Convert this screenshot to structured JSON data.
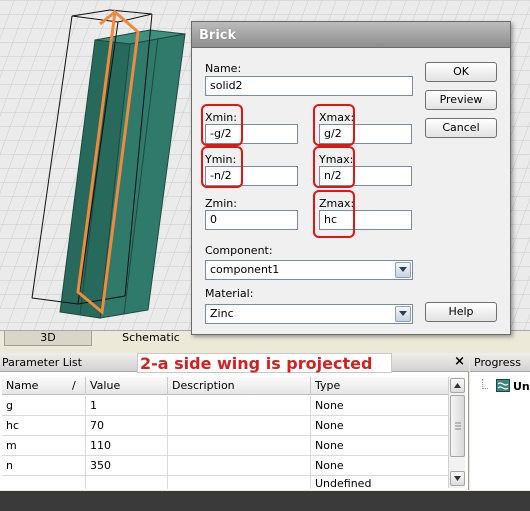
{
  "viewport": {
    "tabs": [
      "3D",
      "Schematic"
    ]
  },
  "dialog": {
    "title": "Brick",
    "name_label": "Name:",
    "name_value": "solid2",
    "xmin_label": "Xmin:",
    "xmin_value": "-g/2",
    "xmax_label": "Xmax:",
    "xmax_value": "g/2",
    "ymin_label": "Ymin:",
    "ymin_value": "-n/2",
    "ymax_label": "Ymax:",
    "ymax_value": "n/2",
    "zmin_label": "Zmin:",
    "zmin_value": "0",
    "zmax_label": "Zmax:",
    "zmax_value": "hc",
    "component_label": "Component:",
    "component_value": "component1",
    "material_label": "Material:",
    "material_value": "Zinc",
    "buttons": {
      "ok": "OK",
      "preview": "Preview",
      "cancel": "Cancel",
      "help": "Help"
    }
  },
  "parameter_list": {
    "title": "Parameter List",
    "annotation": "2-a side wing is projected",
    "columns": [
      "Name",
      "Value",
      "Description",
      "Type"
    ],
    "sort_indicator": "/",
    "rows": [
      {
        "name": "g",
        "value": "1",
        "description": "",
        "type": "None"
      },
      {
        "name": "hc",
        "value": "70",
        "description": "",
        "type": "None"
      },
      {
        "name": "m",
        "value": "110",
        "description": "",
        "type": "None"
      },
      {
        "name": "n",
        "value": "350",
        "description": "",
        "type": "None"
      },
      {
        "name": "",
        "value": "",
        "description": "",
        "type": "Undefined"
      }
    ]
  },
  "progress": {
    "title": "Progress",
    "item_label": "Un"
  },
  "colors": {
    "highlight": "#e01515",
    "solid_fill": "#2f7a6b",
    "wing_edge": "#f08a3c",
    "annotation_text": "#d42020"
  }
}
